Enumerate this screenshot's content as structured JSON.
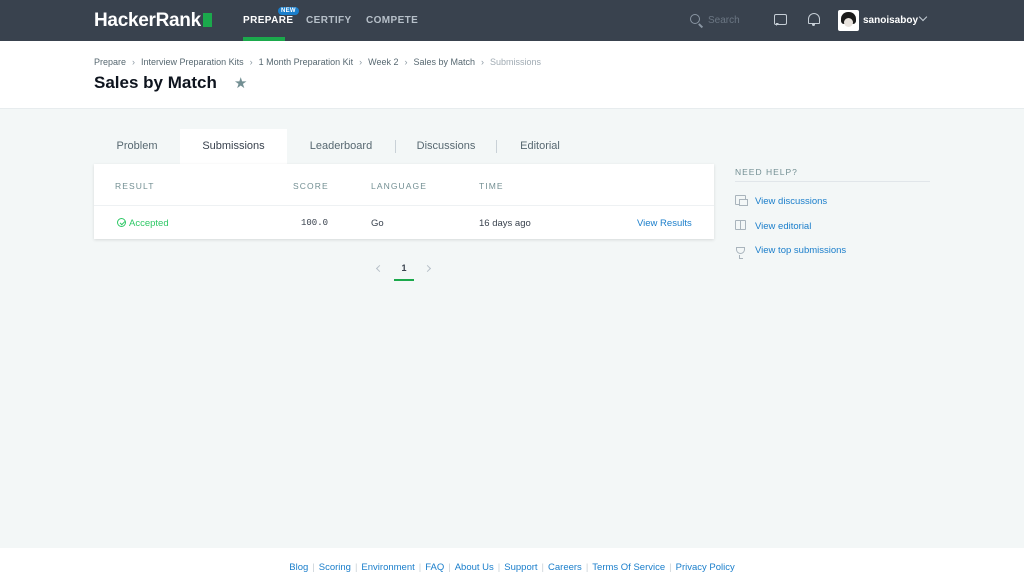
{
  "topnav": {
    "logo_text": "HackerRank",
    "items": [
      {
        "label": "PREPARE",
        "badge": "NEW"
      },
      {
        "label": "CERTIFY"
      },
      {
        "label": "COMPETE"
      }
    ],
    "search_placeholder": "Search",
    "username": "sanoisaboy"
  },
  "breadcrumb": [
    "Prepare",
    "Interview Preparation Kits",
    "1 Month Preparation Kit",
    "Week 2",
    "Sales by Match",
    "Submissions"
  ],
  "page_title": "Sales by Match",
  "tabs": [
    {
      "label": "Problem"
    },
    {
      "label": "Submissions"
    },
    {
      "label": "Leaderboard"
    },
    {
      "label": "Discussions"
    },
    {
      "label": "Editorial"
    }
  ],
  "table": {
    "headers": [
      "RESULT",
      "SCORE",
      "LANGUAGE",
      "TIME"
    ],
    "rows": [
      {
        "result": "Accepted",
        "score": "100.0",
        "language": "Go",
        "time": "16 days ago",
        "action": "View Results"
      }
    ]
  },
  "pagination": {
    "current": "1"
  },
  "sidebar": {
    "title": "NEED HELP?",
    "links": [
      {
        "label": "View discussions",
        "icon": "discussion-icon"
      },
      {
        "label": "View editorial",
        "icon": "book-icon"
      },
      {
        "label": "View top submissions",
        "icon": "trophy-icon"
      }
    ]
  },
  "footer": {
    "links": [
      "Blog",
      "Scoring",
      "Environment",
      "FAQ",
      "About Us",
      "Support",
      "Careers",
      "Terms Of Service",
      "Privacy Policy"
    ]
  },
  "colors": {
    "nav_bg": "#39424e",
    "brand_green": "#1ba94c",
    "accepted_green": "#2ec866",
    "link_blue": "#1a7ecb",
    "page_bg": "#f3f7f7"
  }
}
